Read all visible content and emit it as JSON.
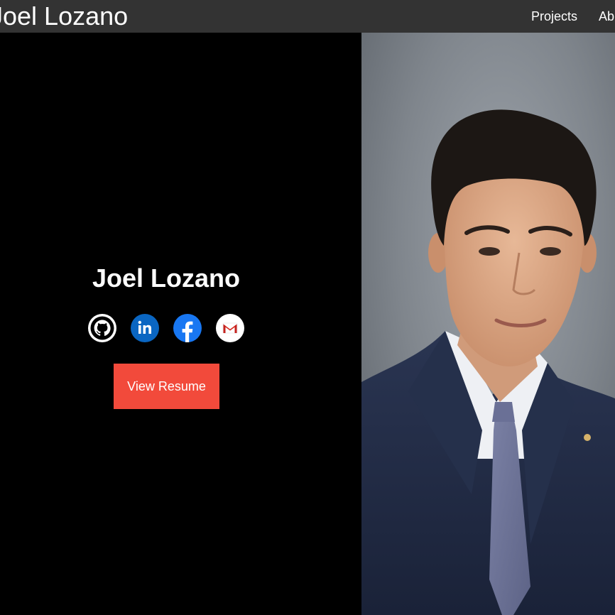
{
  "navbar": {
    "brand": "Joel Lozano",
    "links": [
      {
        "label": "Projects"
      },
      {
        "label": "Ab"
      }
    ]
  },
  "hero": {
    "name": "Joel Lozano",
    "social_icons": [
      "github-icon",
      "linkedin-icon",
      "facebook-icon",
      "gmail-icon"
    ],
    "resume_button_label": "View Resume",
    "photo_description": "portrait-photo"
  },
  "colors": {
    "navbar_bg": "#333333",
    "page_bg": "#000000",
    "accent": "#f24a3b",
    "linkedin": "#0a66c2",
    "facebook": "#1877f2"
  }
}
